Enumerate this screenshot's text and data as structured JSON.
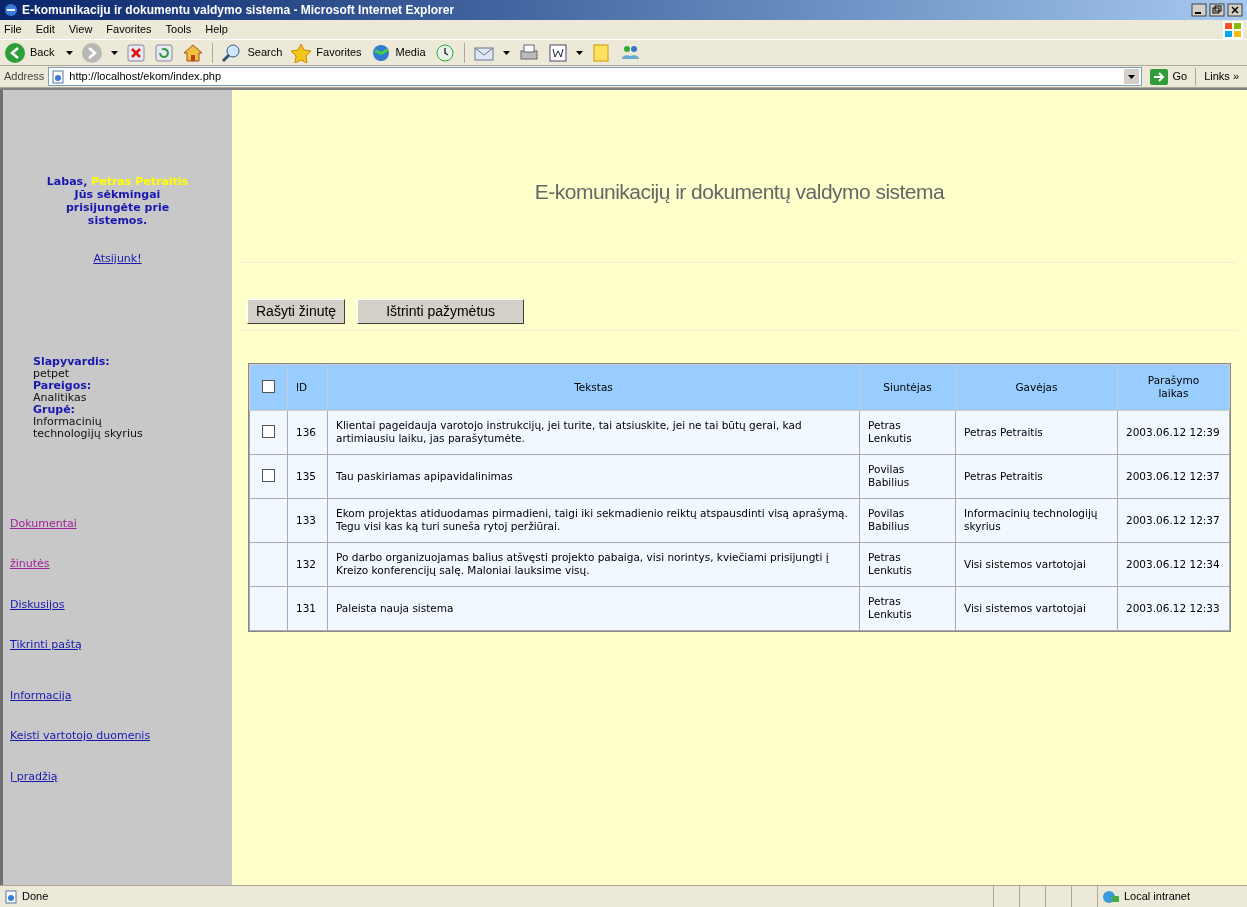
{
  "window": {
    "title": "E-komunikaciju ir dokumentu valdymo sistema - Microsoft Internet Explorer"
  },
  "menu": [
    "File",
    "Edit",
    "View",
    "Favorites",
    "Tools",
    "Help"
  ],
  "toolbar": {
    "back": "Back",
    "search": "Search",
    "favorites": "Favorites",
    "media": "Media"
  },
  "address_bar": {
    "label": "Address",
    "url": "http://localhost/ekom/index.php",
    "go": "Go",
    "links": "Links »"
  },
  "sidebar": {
    "greeting": "Labas,",
    "user_name": "Petras Petraitis",
    "login_message": "Jūs sėkmingai prisijungėte prie sistemos.",
    "logout": "Atsijunk!",
    "profile": [
      {
        "label": "Slapyvardis:",
        "value": "petpet"
      },
      {
        "label": "Pareigos:",
        "value": "Analitikas"
      },
      {
        "label": "Grupė:",
        "value": "Informacinių technologijų skyrius"
      }
    ],
    "nav_groups": [
      [
        {
          "label": "Dokumentai",
          "visited": true
        },
        {
          "label": "žinutės",
          "visited": true
        },
        {
          "label": "Diskusijos",
          "visited": false
        },
        {
          "label": "Tikrinti paštą",
          "visited": false
        }
      ],
      [
        {
          "label": "Informacija",
          "visited": false
        },
        {
          "label": "Keisti vartotojo duomenis",
          "visited": false
        },
        {
          "label": "Į pradžią",
          "visited": false
        }
      ]
    ]
  },
  "page_title": "E-komunikacijų ir dokumentų valdymo sistema",
  "buttons": [
    "Rašyti žinutę",
    "Ištrinti pažymėtus"
  ],
  "table": {
    "columns": [
      "ID",
      "Tekstas",
      "Siuntėjas",
      "Gavėjas",
      "Parašymo laikas"
    ],
    "rows": [
      {
        "has_checkbox": true,
        "checked": false,
        "id": "136",
        "text": "Klientai pageidauja varotojo instrukcijų, jei turite, tai atsiuskite, jei ne tai būtų gerai, kad artimiausiu laiku, jas parašytumėte.",
        "sender": "Petras Lenkutis",
        "recipient": "Petras Petraitis",
        "time": "2003.06.12 12:39"
      },
      {
        "has_checkbox": true,
        "checked": false,
        "id": "135",
        "text": "Tau paskiriamas apipavidalinimas",
        "sender": "Povilas Babilius",
        "recipient": "Petras Petraitis",
        "time": "2003.06.12 12:37"
      },
      {
        "has_checkbox": false,
        "id": "133",
        "text": "Ekom projektas atiduodamas pirmadieni, taigi iki sekmadienio reiktų atspausdinti visą aprašymą. Tegu visi kas ką turi suneša rytoj peržiūrai.",
        "sender": "Povilas Babilius",
        "recipient": "Informacinių technologijų skyrius",
        "time": "2003.06.12 12:37"
      },
      {
        "has_checkbox": false,
        "id": "132",
        "text": "Po darbo organizuojamas balius atšvęsti projekto pabaiga, visi norintys, kviečiami prisijungti į Kreizo konferencijų salę. Maloniai lauksime visų.",
        "sender": "Petras Lenkutis",
        "recipient": "Visi sistemos vartotojai",
        "time": "2003.06.12 12:34"
      },
      {
        "has_checkbox": false,
        "id": "131",
        "text": "Paleista nauja sistema",
        "sender": "Petras Lenkutis",
        "recipient": "Visi sistemos vartotojai",
        "time": "2003.06.12 12:33"
      }
    ],
    "select_all_checked": false
  },
  "status_bar": {
    "status": "Done",
    "zone": "Local intranet"
  }
}
